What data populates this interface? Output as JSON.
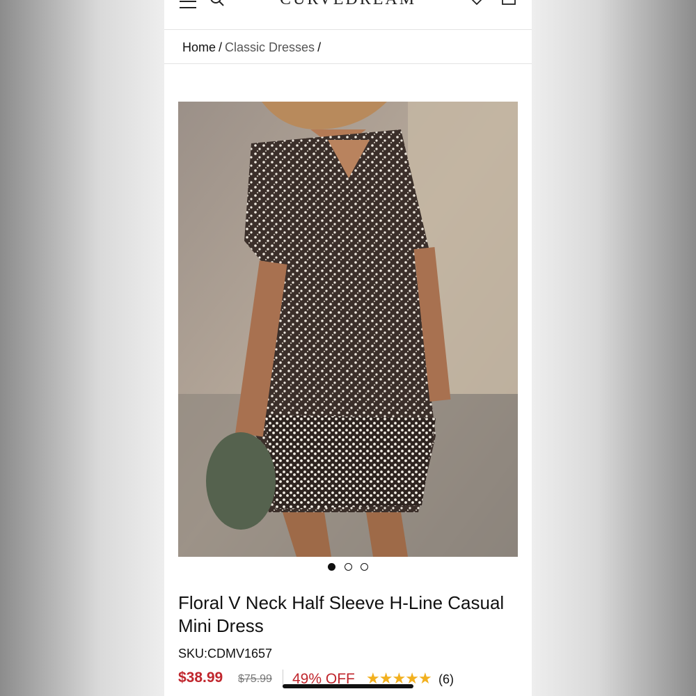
{
  "header": {
    "brand": "CURVEDREAM",
    "icons": [
      "menu-icon",
      "search-icon",
      "heart-icon",
      "bag-icon"
    ]
  },
  "breadcrumb": {
    "home": "Home",
    "category": "Classic Dresses",
    "separator": "/"
  },
  "gallery": {
    "image_count": 3,
    "active_index": 0
  },
  "product": {
    "title": "Floral V Neck Half Sleeve H-Line Casual Mini Dress",
    "sku": "SKU:CDMV1657",
    "price": "$38.99",
    "original_price": "$75.99",
    "discount": "49% OFF",
    "rating": 5,
    "review_count": "(6)"
  },
  "colors": {
    "accent": "#c0262d",
    "star": "#f2b01e"
  }
}
